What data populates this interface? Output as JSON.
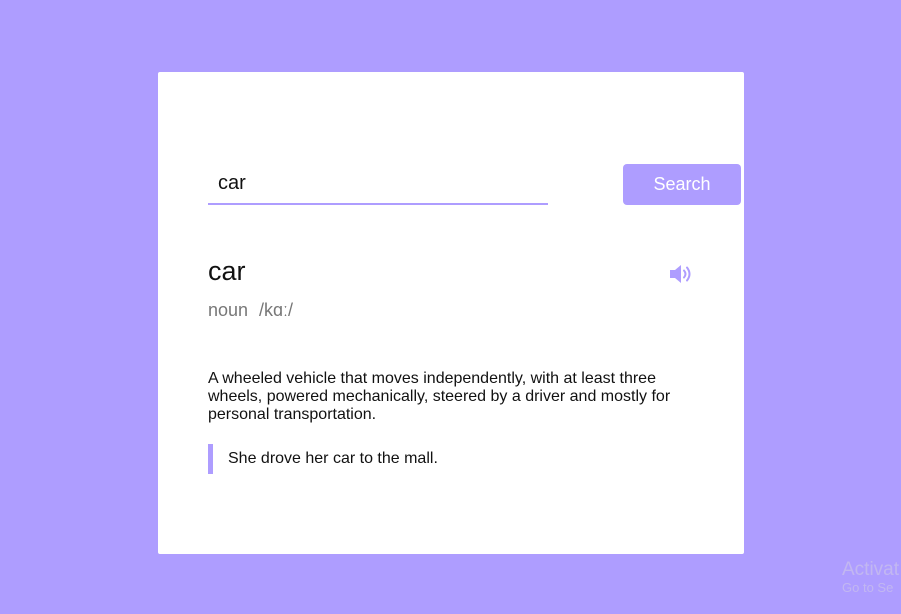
{
  "search": {
    "value": "car",
    "button_label": "Search"
  },
  "result": {
    "word": "car",
    "part_of_speech": "noun",
    "phonetic": "/kɑː/",
    "definition": "A wheeled vehicle that moves independently, with at least three wheels, powered mechanically, steered by a driver and mostly for personal transportation.",
    "example": "She drove her car to the mall.",
    "sound_icon": "speaker-icon"
  },
  "watermark": {
    "line1": "Activat",
    "line2": "Go to Se"
  },
  "colors": {
    "background": "#ae9dff",
    "accent": "#ae9dff",
    "card": "#ffffff"
  }
}
